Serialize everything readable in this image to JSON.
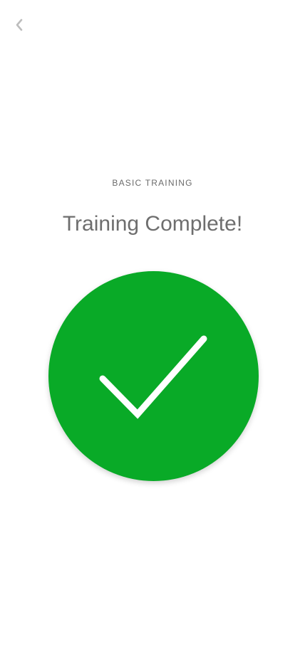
{
  "nav": {
    "back_icon": "chevron-left-icon",
    "back_color": "#bdbdbd"
  },
  "content": {
    "eyebrow": "BASIC TRAINING",
    "title": "Training Complete!"
  },
  "status": {
    "icon": "checkmark-icon",
    "circle_color": "#09aa27",
    "check_color": "#ffffff"
  }
}
